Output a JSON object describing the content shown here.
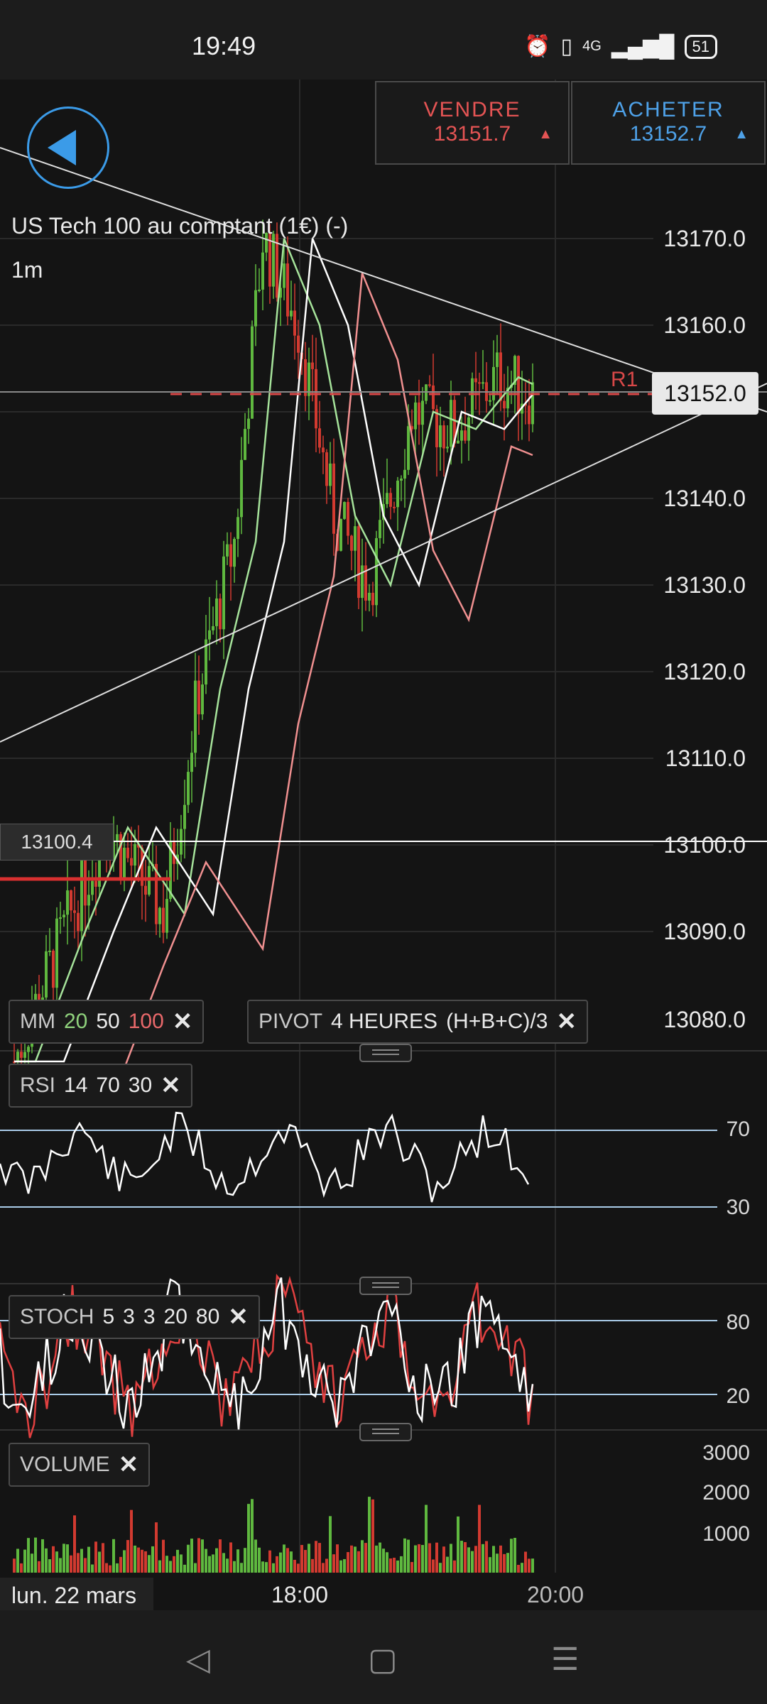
{
  "status": {
    "time": "19:49",
    "network": "4G",
    "battery": "51"
  },
  "trade": {
    "sell_label": "VENDRE",
    "sell_price": "13151.7",
    "buy_label": "ACHETER",
    "buy_price": "13152.7",
    "arrow": "▲"
  },
  "instrument": {
    "title": "US Tech 100 au comptant (1€) (-)",
    "timeframe": "1m"
  },
  "price_axis": [
    "13170.0",
    "13160.0",
    "13140.0",
    "13130.0",
    "13120.0",
    "13110.0",
    "13100.0",
    "13090.0",
    "13080.0"
  ],
  "current_price": "13152.0",
  "pivot_label": "R1",
  "cursor_price": "13100.4",
  "indicators": {
    "mm": {
      "name": "MM",
      "p1": "20",
      "p2": "50",
      "p3": "100"
    },
    "pivot": {
      "name": "PIVOT",
      "period": "4 HEURES",
      "formula": "(H+B+C)/3"
    },
    "rsi": {
      "name": "RSI",
      "p1": "14",
      "p2": "70",
      "p3": "30",
      "levels": [
        "70",
        "30"
      ]
    },
    "stoch": {
      "name": "STOCH",
      "p1": "5",
      "p2": "3",
      "p3": "3",
      "p4": "20",
      "p5": "80",
      "levels": [
        "80",
        "20"
      ]
    },
    "volume": {
      "name": "VOLUME",
      "axis": [
        "3000",
        "2000",
        "1000"
      ]
    },
    "close": "✕"
  },
  "time_axis": {
    "date": "lun. 22 mars",
    "t1": "18:00",
    "t2": "20:00"
  },
  "colors": {
    "up": "#5fb83f",
    "down": "#d23a30",
    "accent": "#3b9be8",
    "sell": "#e45454"
  },
  "icons": {
    "back": "back-arrow-icon",
    "nav": [
      "nav-back-icon",
      "nav-home-icon",
      "nav-menu-icon"
    ]
  }
}
